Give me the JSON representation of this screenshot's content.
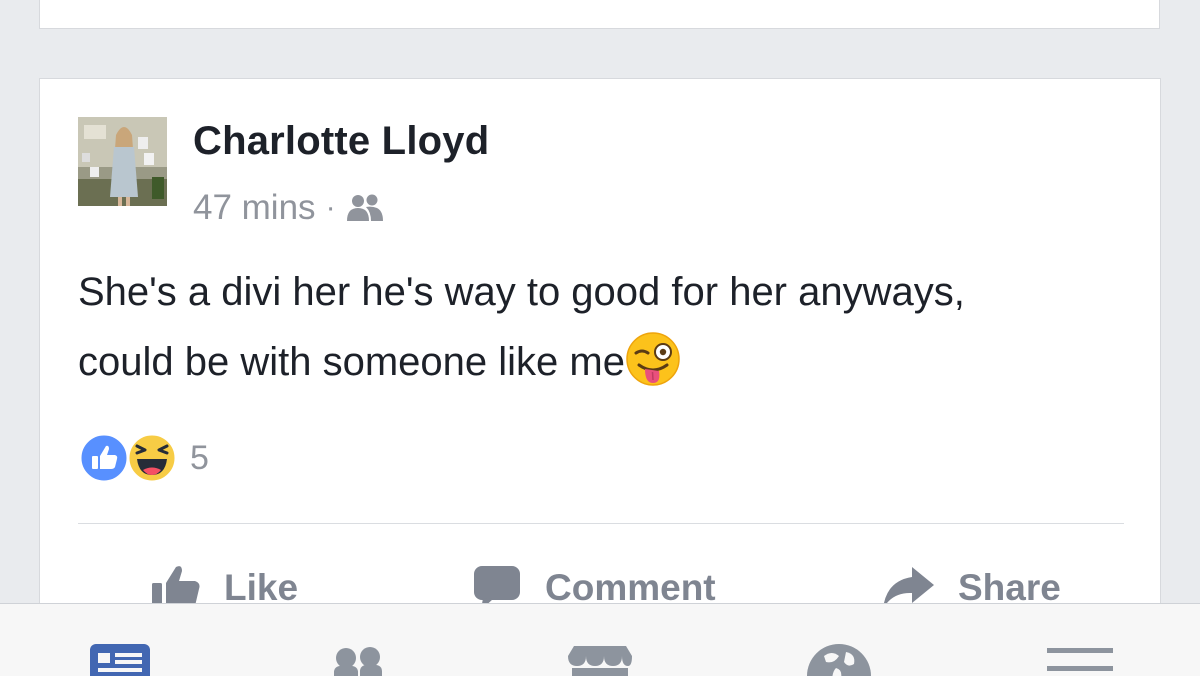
{
  "post": {
    "author_name": "Charlotte Lloyd",
    "timestamp": "47 mins",
    "separator": "·",
    "audience_icon": "friends-icon",
    "text_line1": "She's a divi her he's way to good for her anyways,",
    "text_line2": "could be with someone like me",
    "emoji": "winking-face-with-tongue",
    "reactions": {
      "types": [
        "like",
        "haha"
      ],
      "count": "5"
    }
  },
  "actions": {
    "like_label": "Like",
    "comment_label": "Comment",
    "share_label": "Share"
  },
  "tabbar": {
    "items": [
      "news-feed-icon",
      "friends-icon",
      "marketplace-icon",
      "notifications-globe-icon",
      "menu-icon"
    ],
    "active": "news-feed-icon"
  },
  "colors": {
    "background": "#e9ebee",
    "card": "#ffffff",
    "text": "#1d2129",
    "meta": "#90949c",
    "action": "#7f8591",
    "like_blue": "#5890ff",
    "tab_active": "#4267b2",
    "tab_inactive": "#8d949e"
  }
}
